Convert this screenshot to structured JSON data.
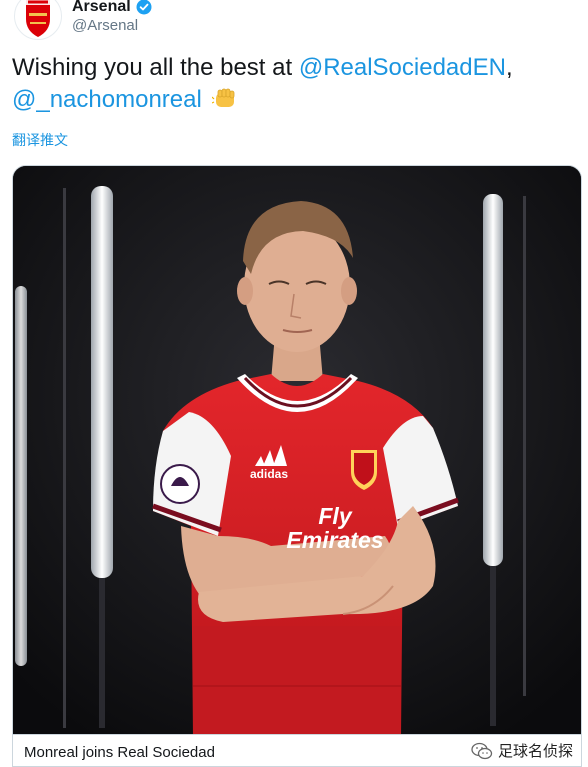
{
  "account": {
    "display_name": "Arsenal",
    "handle": "@Arsenal",
    "avatar_icon": "arsenal-crest-icon",
    "verified_icon": "verified-badge-icon"
  },
  "tweet": {
    "text_prefix": "Wishing you all the best at ",
    "mention_1": "@RealSociedadEN",
    "separator": ",",
    "mention_2": "@_nachomonreal",
    "emoji_icon": "fist-bump-emoji-icon"
  },
  "translate_label": "翻译推文",
  "media": {
    "caption": "Monreal joins Real Sociedad",
    "jersey_sponsor": "Fly Emirates",
    "jersey_brand": "adidas"
  },
  "watermark": {
    "text": "足球名侦探",
    "icon": "wechat-icon"
  },
  "colors": {
    "link": "#1b95e0",
    "arsenal_red": "#db0007",
    "text": "#14171a",
    "secondary_text": "#657786"
  }
}
